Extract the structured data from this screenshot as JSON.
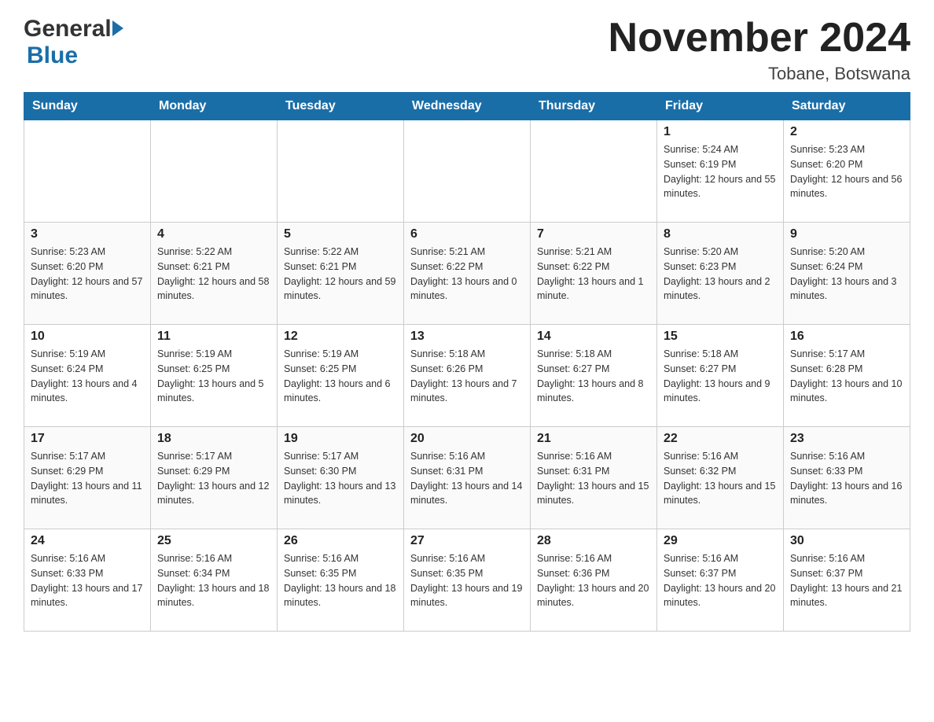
{
  "header": {
    "logo_general": "General",
    "logo_blue": "Blue",
    "title": "November 2024",
    "location": "Tobane, Botswana"
  },
  "weekdays": [
    "Sunday",
    "Monday",
    "Tuesday",
    "Wednesday",
    "Thursday",
    "Friday",
    "Saturday"
  ],
  "weeks": [
    [
      {
        "day": "",
        "sunrise": "",
        "sunset": "",
        "daylight": ""
      },
      {
        "day": "",
        "sunrise": "",
        "sunset": "",
        "daylight": ""
      },
      {
        "day": "",
        "sunrise": "",
        "sunset": "",
        "daylight": ""
      },
      {
        "day": "",
        "sunrise": "",
        "sunset": "",
        "daylight": ""
      },
      {
        "day": "",
        "sunrise": "",
        "sunset": "",
        "daylight": ""
      },
      {
        "day": "1",
        "sunrise": "Sunrise: 5:24 AM",
        "sunset": "Sunset: 6:19 PM",
        "daylight": "Daylight: 12 hours and 55 minutes."
      },
      {
        "day": "2",
        "sunrise": "Sunrise: 5:23 AM",
        "sunset": "Sunset: 6:20 PM",
        "daylight": "Daylight: 12 hours and 56 minutes."
      }
    ],
    [
      {
        "day": "3",
        "sunrise": "Sunrise: 5:23 AM",
        "sunset": "Sunset: 6:20 PM",
        "daylight": "Daylight: 12 hours and 57 minutes."
      },
      {
        "day": "4",
        "sunrise": "Sunrise: 5:22 AM",
        "sunset": "Sunset: 6:21 PM",
        "daylight": "Daylight: 12 hours and 58 minutes."
      },
      {
        "day": "5",
        "sunrise": "Sunrise: 5:22 AM",
        "sunset": "Sunset: 6:21 PM",
        "daylight": "Daylight: 12 hours and 59 minutes."
      },
      {
        "day": "6",
        "sunrise": "Sunrise: 5:21 AM",
        "sunset": "Sunset: 6:22 PM",
        "daylight": "Daylight: 13 hours and 0 minutes."
      },
      {
        "day": "7",
        "sunrise": "Sunrise: 5:21 AM",
        "sunset": "Sunset: 6:22 PM",
        "daylight": "Daylight: 13 hours and 1 minute."
      },
      {
        "day": "8",
        "sunrise": "Sunrise: 5:20 AM",
        "sunset": "Sunset: 6:23 PM",
        "daylight": "Daylight: 13 hours and 2 minutes."
      },
      {
        "day": "9",
        "sunrise": "Sunrise: 5:20 AM",
        "sunset": "Sunset: 6:24 PM",
        "daylight": "Daylight: 13 hours and 3 minutes."
      }
    ],
    [
      {
        "day": "10",
        "sunrise": "Sunrise: 5:19 AM",
        "sunset": "Sunset: 6:24 PM",
        "daylight": "Daylight: 13 hours and 4 minutes."
      },
      {
        "day": "11",
        "sunrise": "Sunrise: 5:19 AM",
        "sunset": "Sunset: 6:25 PM",
        "daylight": "Daylight: 13 hours and 5 minutes."
      },
      {
        "day": "12",
        "sunrise": "Sunrise: 5:19 AM",
        "sunset": "Sunset: 6:25 PM",
        "daylight": "Daylight: 13 hours and 6 minutes."
      },
      {
        "day": "13",
        "sunrise": "Sunrise: 5:18 AM",
        "sunset": "Sunset: 6:26 PM",
        "daylight": "Daylight: 13 hours and 7 minutes."
      },
      {
        "day": "14",
        "sunrise": "Sunrise: 5:18 AM",
        "sunset": "Sunset: 6:27 PM",
        "daylight": "Daylight: 13 hours and 8 minutes."
      },
      {
        "day": "15",
        "sunrise": "Sunrise: 5:18 AM",
        "sunset": "Sunset: 6:27 PM",
        "daylight": "Daylight: 13 hours and 9 minutes."
      },
      {
        "day": "16",
        "sunrise": "Sunrise: 5:17 AM",
        "sunset": "Sunset: 6:28 PM",
        "daylight": "Daylight: 13 hours and 10 minutes."
      }
    ],
    [
      {
        "day": "17",
        "sunrise": "Sunrise: 5:17 AM",
        "sunset": "Sunset: 6:29 PM",
        "daylight": "Daylight: 13 hours and 11 minutes."
      },
      {
        "day": "18",
        "sunrise": "Sunrise: 5:17 AM",
        "sunset": "Sunset: 6:29 PM",
        "daylight": "Daylight: 13 hours and 12 minutes."
      },
      {
        "day": "19",
        "sunrise": "Sunrise: 5:17 AM",
        "sunset": "Sunset: 6:30 PM",
        "daylight": "Daylight: 13 hours and 13 minutes."
      },
      {
        "day": "20",
        "sunrise": "Sunrise: 5:16 AM",
        "sunset": "Sunset: 6:31 PM",
        "daylight": "Daylight: 13 hours and 14 minutes."
      },
      {
        "day": "21",
        "sunrise": "Sunrise: 5:16 AM",
        "sunset": "Sunset: 6:31 PM",
        "daylight": "Daylight: 13 hours and 15 minutes."
      },
      {
        "day": "22",
        "sunrise": "Sunrise: 5:16 AM",
        "sunset": "Sunset: 6:32 PM",
        "daylight": "Daylight: 13 hours and 15 minutes."
      },
      {
        "day": "23",
        "sunrise": "Sunrise: 5:16 AM",
        "sunset": "Sunset: 6:33 PM",
        "daylight": "Daylight: 13 hours and 16 minutes."
      }
    ],
    [
      {
        "day": "24",
        "sunrise": "Sunrise: 5:16 AM",
        "sunset": "Sunset: 6:33 PM",
        "daylight": "Daylight: 13 hours and 17 minutes."
      },
      {
        "day": "25",
        "sunrise": "Sunrise: 5:16 AM",
        "sunset": "Sunset: 6:34 PM",
        "daylight": "Daylight: 13 hours and 18 minutes."
      },
      {
        "day": "26",
        "sunrise": "Sunrise: 5:16 AM",
        "sunset": "Sunset: 6:35 PM",
        "daylight": "Daylight: 13 hours and 18 minutes."
      },
      {
        "day": "27",
        "sunrise": "Sunrise: 5:16 AM",
        "sunset": "Sunset: 6:35 PM",
        "daylight": "Daylight: 13 hours and 19 minutes."
      },
      {
        "day": "28",
        "sunrise": "Sunrise: 5:16 AM",
        "sunset": "Sunset: 6:36 PM",
        "daylight": "Daylight: 13 hours and 20 minutes."
      },
      {
        "day": "29",
        "sunrise": "Sunrise: 5:16 AM",
        "sunset": "Sunset: 6:37 PM",
        "daylight": "Daylight: 13 hours and 20 minutes."
      },
      {
        "day": "30",
        "sunrise": "Sunrise: 5:16 AM",
        "sunset": "Sunset: 6:37 PM",
        "daylight": "Daylight: 13 hours and 21 minutes."
      }
    ]
  ]
}
